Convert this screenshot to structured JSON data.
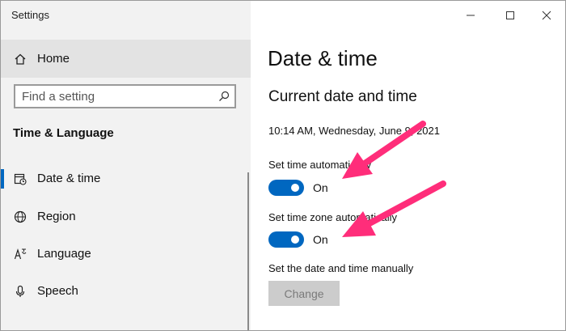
{
  "window": {
    "title": "Settings"
  },
  "sidebar": {
    "home_label": "Home",
    "search": {
      "placeholder": "Find a setting"
    },
    "section_title": "Time & Language",
    "items": [
      {
        "label": "Date & time",
        "icon": "date-time-icon",
        "selected": true
      },
      {
        "label": "Region",
        "icon": "globe-icon"
      },
      {
        "label": "Language",
        "icon": "language-icon"
      },
      {
        "label": "Speech",
        "icon": "microphone-icon"
      }
    ]
  },
  "main": {
    "page_title": "Date & time",
    "section_title": "Current date and time",
    "current_datetime": "10:14 AM, Wednesday, June 9, 2021",
    "settings": [
      {
        "label": "Set time automatically",
        "state": "On",
        "on": true
      },
      {
        "label": "Set time zone automatically",
        "state": "On",
        "on": true
      }
    ],
    "manual": {
      "label": "Set the date and time manually",
      "button_label": "Change"
    }
  },
  "colors": {
    "accent": "#0067c0",
    "annotation_arrow": "#ff2d7a",
    "sidebar_bg": "#f2f2f2"
  }
}
